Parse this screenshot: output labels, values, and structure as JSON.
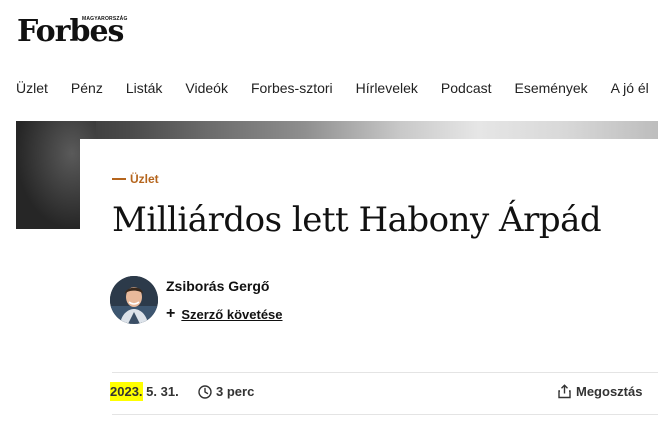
{
  "header": {
    "logo": "Forbes",
    "logo_edition": "MAGYARORSZÁG"
  },
  "nav": {
    "items": [
      "Üzlet",
      "Pénz",
      "Listák",
      "Videók",
      "Forbes-sztori",
      "Hírlevelek",
      "Podcast",
      "Események",
      "A jó él"
    ]
  },
  "article": {
    "category": "Üzlet",
    "title": "Milliárdos lett Habony Árpád",
    "author": "Zsiborás Gergő",
    "follow_label": "Szerző követése",
    "date_year": "2023.",
    "date_rest": " 5. 31.",
    "read_time": "3 perc",
    "share_label": "Megosztás",
    "accent_color": "#b5651d",
    "highlight_color": "#ffff00"
  },
  "icons": {
    "clock": "clock-icon",
    "share": "share-icon",
    "plus": "plus-icon"
  }
}
